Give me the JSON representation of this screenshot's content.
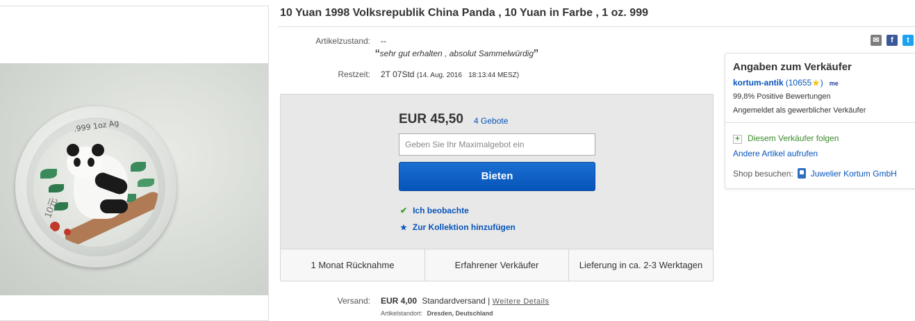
{
  "item": {
    "title": "10 Yuan 1998 Volksrepublik China Panda , 10 Yuan in Farbe , 1 oz. 999",
    "image_alt": "China Panda 10 Yuan coin in capsule",
    "coin_text": ".999 1oz Ag",
    "coin_value": "10元"
  },
  "condition": {
    "label": "Artikelzustand:",
    "value": "--",
    "quote_open": "“",
    "quote_text": "sehr gut erhalten , absolut Sammelwürdig",
    "quote_close": "”"
  },
  "timeleft": {
    "label": "Restzeit:",
    "value": "2T 07Std",
    "date": "(14. Aug. 2016",
    "time": "18:13:44 MESZ)"
  },
  "share": {
    "mail_icon": "mail-icon",
    "facebook_icon": "facebook-icon",
    "twitter_icon": "twitter-icon"
  },
  "bid": {
    "price": "EUR 45,50",
    "bids": "4 Gebote",
    "input_placeholder": "Geben Sie Ihr Maximalgebot ein",
    "button_label": "Bieten",
    "watch_label": "Ich beobachte",
    "collection_label": "Zur Kollektion hinzufügen"
  },
  "features": [
    {
      "label": "1 Monat Rücknahme"
    },
    {
      "label": "Erfahrener Verkäufer"
    },
    {
      "label": "Lieferung in ca. 2-3 Werktagen"
    }
  ],
  "shipping": {
    "label": "Versand:",
    "price": "EUR 4,00",
    "method": "Standardversand",
    "divider": "|",
    "details_link": "Weitere Details",
    "location_label": "Artikelstandort:",
    "location": "Dresden, Deutschland"
  },
  "seller": {
    "heading": "Angaben zum Verkäufer",
    "name": "kortum-antik",
    "score_open": "(",
    "score": "10655",
    "score_close": ")",
    "me_badge": "me",
    "positive": "99,8% Positive Bewertungen",
    "type": "Angemeldet als gewerblicher Verkäufer",
    "follow": "Diesem Verkäufer folgen",
    "other_items": "Andere Artikel aufrufen",
    "shop_label": "Shop besuchen:",
    "shop_name": "Juwelier Kortum GmbH"
  }
}
